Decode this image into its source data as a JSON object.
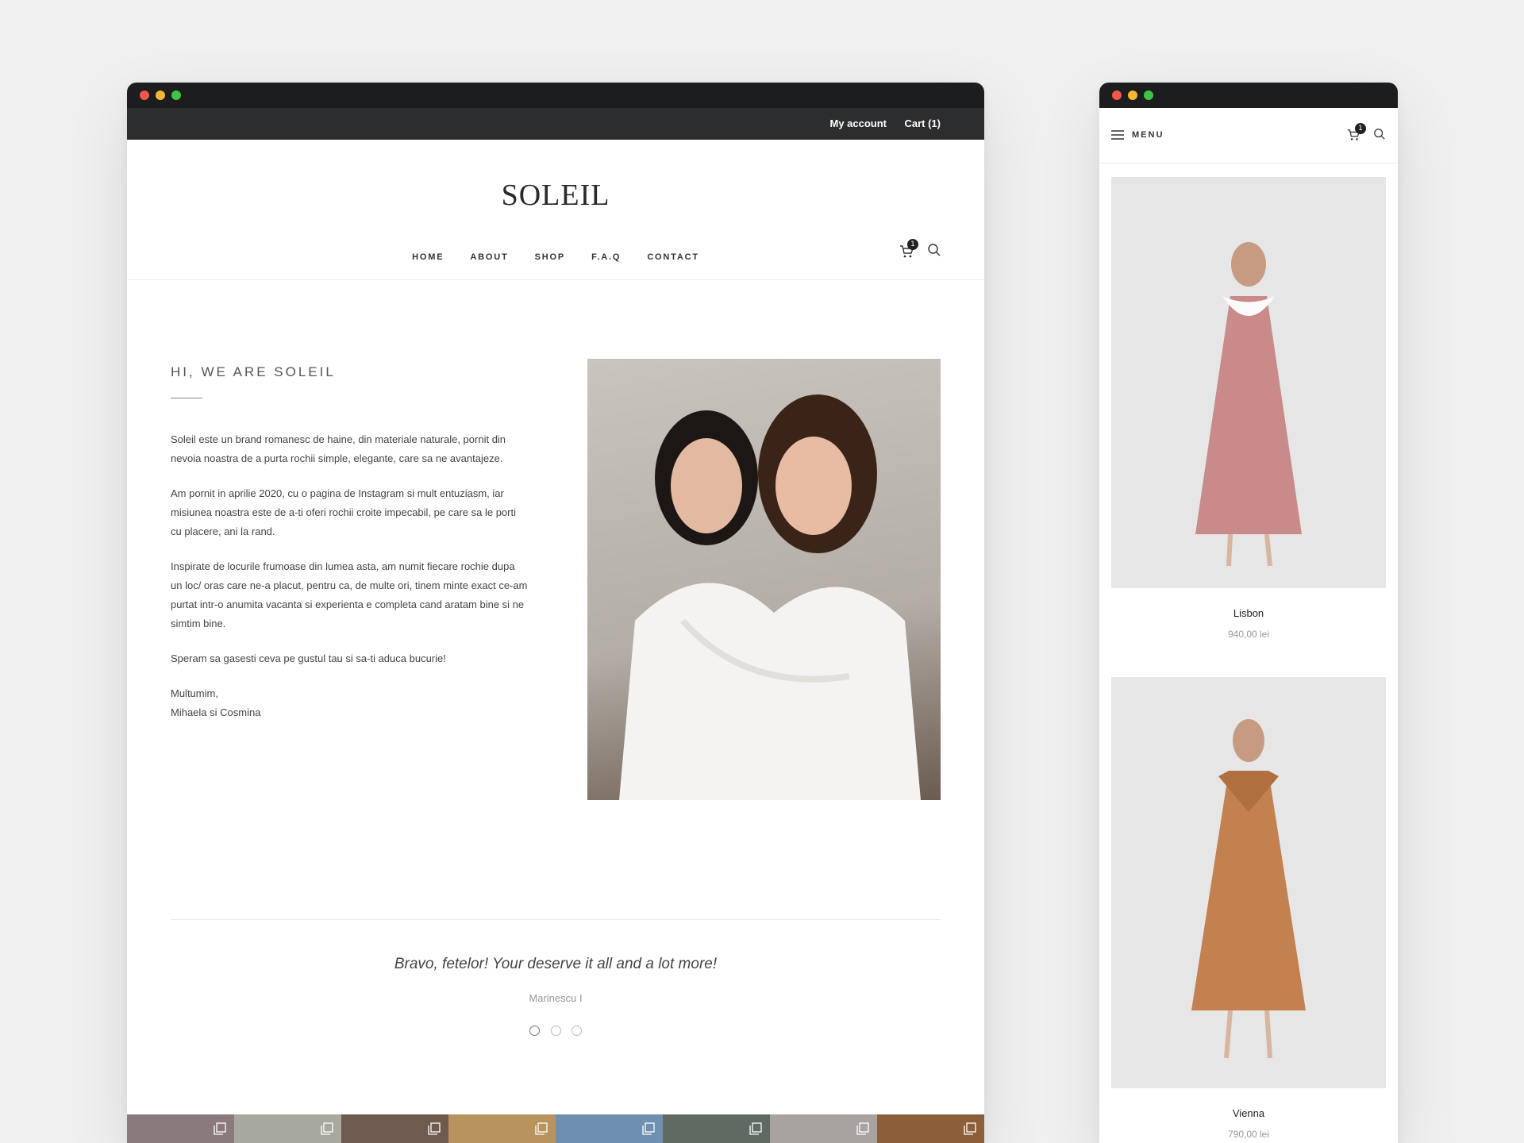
{
  "desktop": {
    "topbar": {
      "account": "My account",
      "cart": "Cart (1)"
    },
    "logo": "SOLEIL",
    "nav": [
      "HOME",
      "ABOUT",
      "SHOP",
      "F.A.Q",
      "CONTACT"
    ],
    "cart_count": "1",
    "about": {
      "title": "HI, WE ARE SOLEIL",
      "paragraphs": [
        "Soleil este un brand romanesc de haine, din materiale naturale, pornit din nevoia noastra de a purta rochii simple, elegante, care sa ne avantajeze.",
        "Am pornit in aprilie 2020, cu o pagina de Instagram si mult entuziasm, iar misiunea noastra este de a-ti oferi rochii croite impecabil, pe care sa le porti cu placere, ani la rand.",
        "Inspirate de locurile frumoase din lumea asta, am numit fiecare rochie dupa un loc/ oras care ne-a placut, pentru ca, de multe ori, tinem minte exact ce-am purtat intr-o anumita vacanta si experienta e completa cand aratam bine si ne simtim bine.",
        "Speram sa gasesti ceva pe gustul tau si sa-ti aduca bucurie!"
      ],
      "signoff_1": "Multumim,",
      "signoff_2": "Mihaela si Cosmina"
    },
    "testimonial": {
      "quote": "Bravo, fetelor! Your deserve it all and a lot more!",
      "author": "Marinescu I"
    },
    "insta_colors": [
      "#8b7a7d",
      "#a7a89e",
      "#6e5a4e",
      "#b9935e",
      "#6f8fb1",
      "#5f6a63",
      "#a8a2a0",
      "#8c5e3a"
    ]
  },
  "mobile": {
    "menu_label": "MENU",
    "cart_count": "1",
    "products": [
      {
        "name": "Lisbon",
        "price": "940,00 lei",
        "dress_color": "#c98a8a"
      },
      {
        "name": "Vienna",
        "price": "790,00 lei",
        "dress_color": "#c2814e"
      }
    ]
  }
}
